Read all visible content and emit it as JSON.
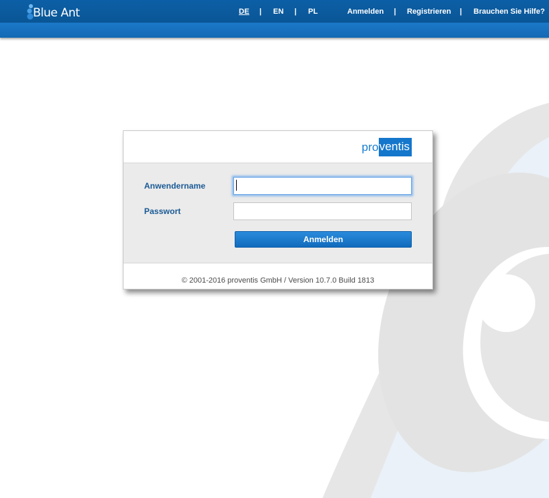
{
  "header": {
    "logo_text": "Blue Ant",
    "languages": [
      {
        "label": "DE",
        "active": true
      },
      {
        "label": "EN",
        "active": false
      },
      {
        "label": "PL",
        "active": false
      }
    ],
    "separator": "|",
    "links": {
      "login": "Anmelden",
      "register": "Registrieren",
      "help": "Brauchen Sie Hilfe?"
    }
  },
  "login": {
    "brand_pro": "pro",
    "brand_ventis": "ventis",
    "username_label": "Anwendername",
    "username_value": "",
    "password_label": "Passwort",
    "password_value": "",
    "submit_label": "Anmelden",
    "footer": "© 2001-2016 proventis GmbH / Version 10.7.0 Build 1813"
  },
  "colors": {
    "header": "#0c5fa6",
    "subheader": "#1b78c8",
    "label": "#1b5a95",
    "button": "#1a7bd0",
    "brand": "#1477cc"
  }
}
